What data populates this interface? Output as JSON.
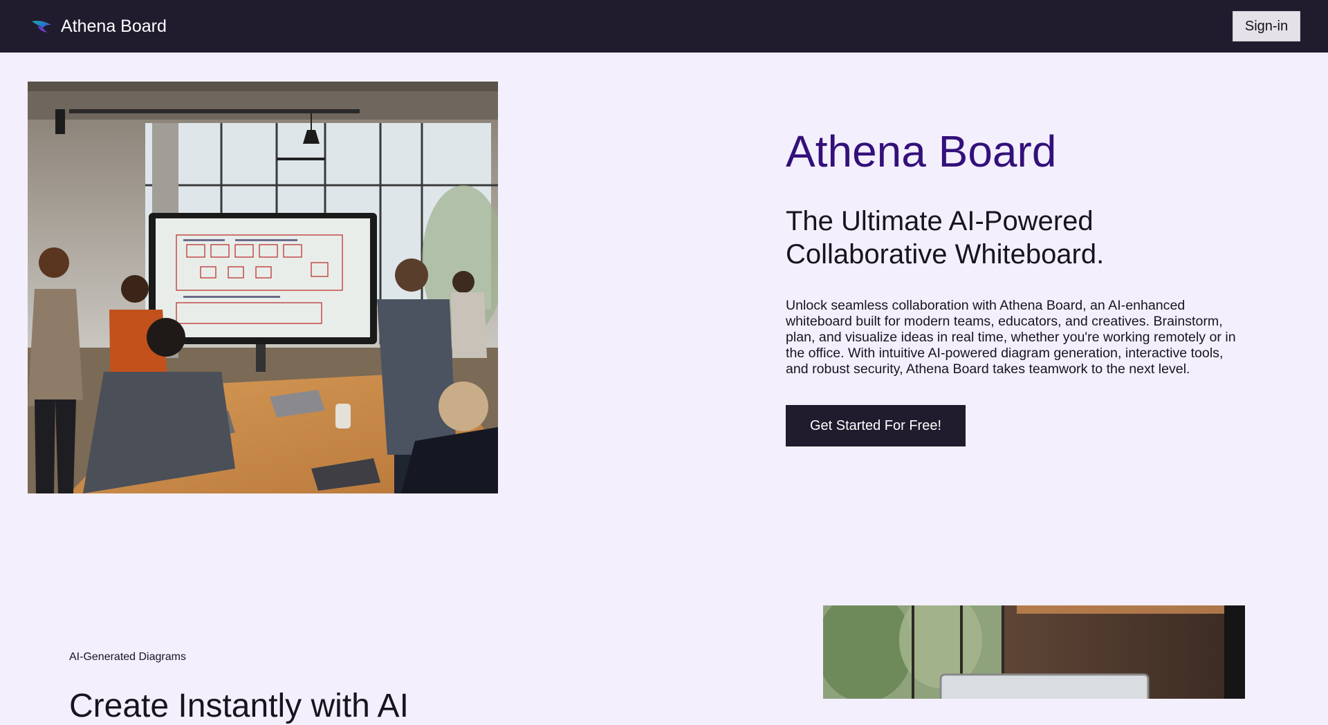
{
  "header": {
    "brand_name": "Athena Board",
    "signin_label": "Sign-in"
  },
  "hero": {
    "title": "Athena Board",
    "subtitle": "The Ultimate AI-Powered Collaborative Whiteboard.",
    "description": "Unlock seamless collaboration with Athena Board, an AI-enhanced whiteboard built for modern teams, educators, and creatives. Brainstorm, plan, and visualize ideas in real time, whether you're working remotely or in the office. With intuitive AI-powered diagram generation, interactive tools, and robust security, Athena Board takes teamwork to the next level.",
    "cta_label": "Get Started For Free!"
  },
  "feature": {
    "label": "AI-Generated Diagrams",
    "heading": "Create Instantly with AI"
  },
  "colors": {
    "header_bg": "#211b2e",
    "page_bg": "#f3effd",
    "title_accent": "#33107a",
    "cta_bg": "#211b2e"
  },
  "icons": {
    "logo": "athena-logo-icon"
  }
}
